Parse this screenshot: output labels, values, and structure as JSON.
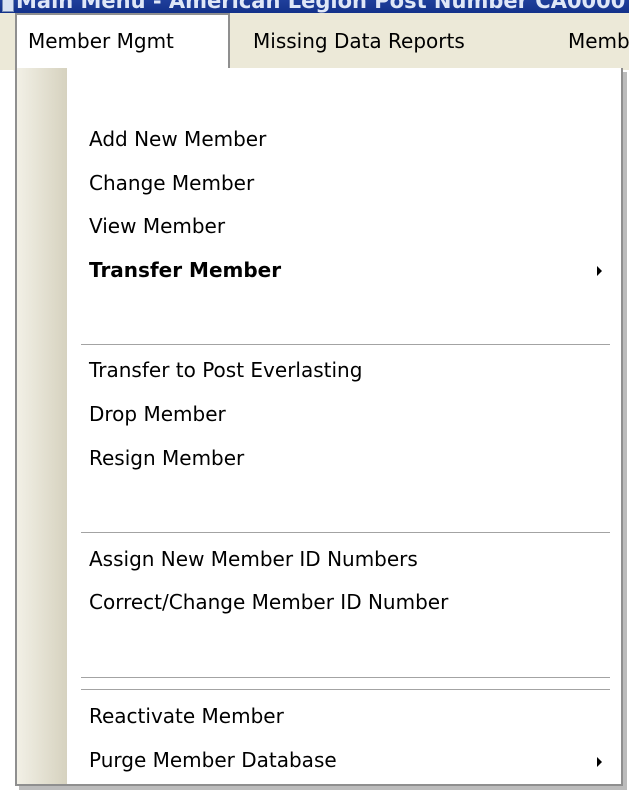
{
  "window": {
    "title": "Main Menu - American Legion Post Number CA0000"
  },
  "menubar": {
    "items": [
      {
        "label": "Member Mgmt"
      },
      {
        "label": "Missing Data Reports"
      },
      {
        "label": "Memb"
      }
    ]
  },
  "dropdown": {
    "items": [
      {
        "label": "Add New Member"
      },
      {
        "label": "Change Member"
      },
      {
        "label": "View Member"
      },
      {
        "label": "Transfer Member"
      },
      {
        "label": "Transfer to Post Everlasting"
      },
      {
        "label": "Drop Member"
      },
      {
        "label": "Resign Member"
      },
      {
        "label": "Assign New Member ID Numbers"
      },
      {
        "label": "Correct/Change Member ID Number"
      },
      {
        "label": "Reactivate Member"
      },
      {
        "label": "Purge Member Database"
      }
    ]
  },
  "icons": {
    "submenu": "submenu-arrow-icon",
    "app": "app-icon"
  }
}
